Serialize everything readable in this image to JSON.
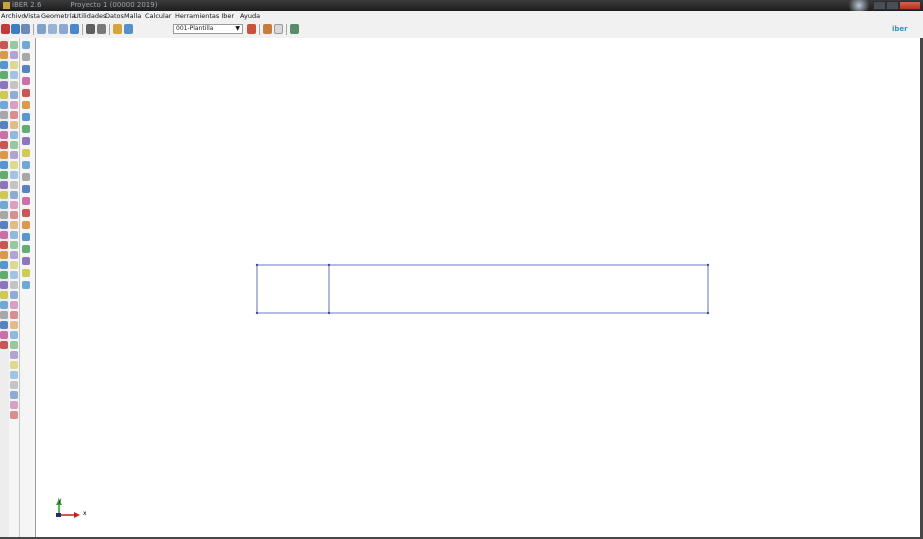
{
  "window": {
    "title": "iBER 2.6",
    "project_title": "Proyecto 1 (00000 2019)",
    "controls": [
      "minimize",
      "maximize",
      "close"
    ]
  },
  "menu": {
    "items": [
      "Archivo",
      "Vista",
      "Geometría",
      "Utilidades",
      "Datos",
      "Malla",
      "Calcular",
      "Herramientas Iber",
      "Ayuda"
    ]
  },
  "toolbar": {
    "layer_select_value": "001-Plantilla",
    "logo_text": "iber",
    "icons": [
      "open-icon",
      "save-icon",
      "print-icon",
      "rotate-icon",
      "zoom-icon",
      "pan-icon",
      "move-icon",
      "camera-icon",
      "layers-icon",
      "draw-icon",
      "layer-icon",
      "stack-icon",
      "settings-icon",
      "help-icon",
      "exit-icon"
    ]
  },
  "left_toolbar": {
    "icons": [
      "point-icon",
      "line-icon",
      "arc-icon",
      "polyline-icon",
      "surface-icon",
      "volume-icon",
      "delete-icon",
      "copy-icon",
      "move-icon",
      "mesh-icon",
      "boundary-icon",
      "inlet-icon",
      "outlet-icon",
      "roughness-icon",
      "result-icon",
      "contour-icon",
      "vector-icon",
      "graph-icon",
      "animation-icon",
      "measure-icon"
    ]
  },
  "viewport": {
    "axis_x_label": "x",
    "axis_y_label": "y",
    "line_color": "#3c4ea6"
  }
}
